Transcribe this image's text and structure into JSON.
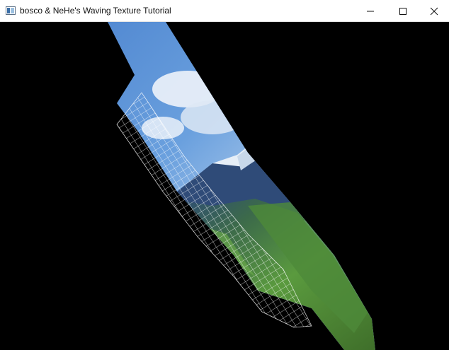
{
  "window": {
    "title": "bosco & NeHe's Waving Texture Tutorial",
    "app_icon": "window-app-icon",
    "controls": {
      "minimize_icon": "minimize-icon",
      "maximize_icon": "maximize-icon",
      "close_icon": "close-icon"
    }
  },
  "scene": {
    "background_color": "#000000",
    "texture_description_icon": "waving-texture-flag",
    "sky_color": "#5a92d6",
    "cloud_color": "#e8eef6",
    "mountain_color": "#2f4b78",
    "snow_color": "#dfe9f4",
    "grass_color": "#4f8f3a",
    "mesh_color": "#ffffff"
  }
}
